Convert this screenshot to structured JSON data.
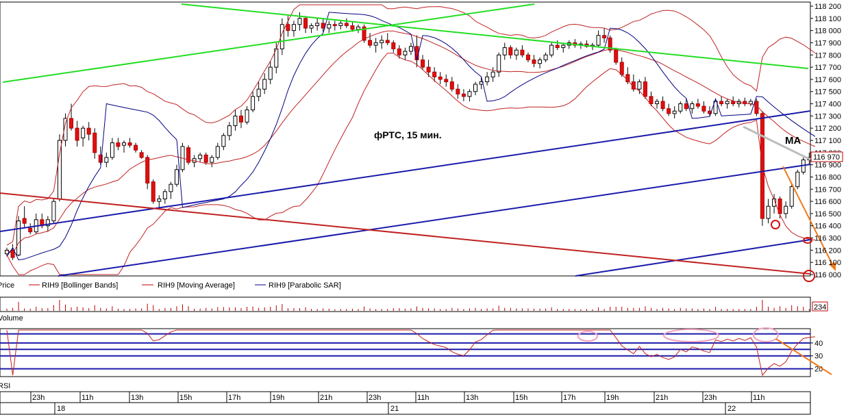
{
  "chart_data": {
    "type": "candlestick",
    "title": "фРТС,  15 мин.",
    "annotation_ma": "MA",
    "price_axis": {
      "ylim": [
        116000,
        118200
      ],
      "ticks": [
        118200,
        118100,
        118000,
        117900,
        117800,
        117700,
        117600,
        117500,
        117400,
        117300,
        117200,
        117100,
        117000,
        116900,
        116800,
        116700,
        116600,
        116500,
        116400,
        116300,
        116200,
        116100,
        116000
      ],
      "tick_labels": [
        "118 200",
        "118 100",
        "118 000",
        "117 900",
        "117 800",
        "117 700",
        "117 600",
        "117 500",
        "117 400",
        "117 300",
        "117 200",
        "117 100",
        "117 000",
        "116 900",
        "116 800",
        "116 700",
        "116 600",
        "116 500",
        "116 400",
        "116 300",
        "116 200",
        "116 100",
        "116 000"
      ],
      "last_price_label": "116 970",
      "last_price": 116970
    },
    "legend": [
      {
        "name": "Price",
        "color": "#000000"
      },
      {
        "name": "RIH9 [Bollinger Bands]",
        "color": "#c00000"
      },
      {
        "name": "RIH9 [Moving Average]",
        "color": "#c00000"
      },
      {
        "name": "RIH9 [Parabolic SAR]",
        "color": "#000080"
      }
    ],
    "volume_panel": {
      "label": "Volume",
      "last_value_label": "234"
    },
    "rsi_panel": {
      "label": "RSI",
      "levels": [
        47,
        40,
        35,
        30,
        20
      ],
      "tick_labels": [
        "40",
        "30",
        "20"
      ]
    },
    "time_axis": {
      "hour_labels": [
        "23h",
        "11h",
        "13h",
        "15h",
        "17h",
        "19h",
        "21h",
        "23h",
        "11h",
        "13h",
        "15h",
        "17h",
        "19h",
        "21h",
        "23h",
        "11h"
      ],
      "day_labels": [
        "18",
        "21",
        "22"
      ]
    },
    "candles": [
      [
        116170,
        116220,
        116150,
        116200
      ],
      [
        116200,
        116250,
        116120,
        116140
      ],
      [
        116160,
        116480,
        116150,
        116440
      ],
      [
        116460,
        116560,
        116380,
        116420
      ],
      [
        116380,
        116420,
        116330,
        116350
      ],
      [
        116350,
        116500,
        116330,
        116450
      ],
      [
        116450,
        116500,
        116380,
        116400
      ],
      [
        116400,
        116480,
        116350,
        116450
      ],
      [
        116440,
        116620,
        116420,
        116600
      ],
      [
        116620,
        117150,
        116600,
        117100
      ],
      [
        117100,
        117320,
        117050,
        117280
      ],
      [
        117280,
        117400,
        117180,
        117200
      ],
      [
        117200,
        117260,
        117050,
        117100
      ],
      [
        117120,
        117220,
        117050,
        117200
      ],
      [
        117200,
        117250,
        117100,
        117150
      ],
      [
        117160,
        117200,
        116950,
        117000
      ],
      [
        116980,
        117050,
        116900,
        116920
      ],
      [
        116920,
        117000,
        116880,
        116960
      ],
      [
        116960,
        117120,
        116940,
        117080
      ],
      [
        117080,
        117120,
        117020,
        117050
      ],
      [
        117060,
        117100,
        117000,
        117080
      ],
      [
        117080,
        117120,
        117040,
        117060
      ],
      [
        117060,
        117080,
        117000,
        117020
      ],
      [
        117000,
        117020,
        116950,
        116960
      ],
      [
        116960,
        116980,
        116700,
        116750
      ],
      [
        116760,
        116780,
        116580,
        116600
      ],
      [
        116600,
        116650,
        116550,
        116620
      ],
      [
        116620,
        116700,
        116580,
        116680
      ],
      [
        116680,
        116760,
        116620,
        116740
      ],
      [
        116740,
        116900,
        116720,
        116860
      ],
      [
        116860,
        117080,
        116840,
        117050
      ],
      [
        117040,
        117060,
        116900,
        116920
      ],
      [
        116920,
        116980,
        116880,
        116950
      ],
      [
        116950,
        117000,
        116920,
        116980
      ],
      [
        116980,
        117000,
        116900,
        116920
      ],
      [
        116920,
        116980,
        116880,
        116960
      ],
      [
        116960,
        117080,
        116940,
        117050
      ],
      [
        117050,
        117160,
        117020,
        117140
      ],
      [
        117140,
        117250,
        117100,
        117220
      ],
      [
        117220,
        117350,
        117180,
        117300
      ],
      [
        117300,
        117350,
        117200,
        117250
      ],
      [
        117250,
        117380,
        117230,
        117350
      ],
      [
        117350,
        117500,
        117330,
        117460
      ],
      [
        117460,
        117580,
        117420,
        117520
      ],
      [
        117520,
        117650,
        117480,
        117600
      ],
      [
        117600,
        117750,
        117560,
        117700
      ],
      [
        117700,
        117900,
        117650,
        117850
      ],
      [
        117850,
        118100,
        117800,
        118050
      ],
      [
        118050,
        118120,
        117950,
        118000
      ],
      [
        118000,
        118080,
        117950,
        118050
      ],
      [
        118050,
        118150,
        118000,
        118100
      ],
      [
        118100,
        118120,
        117980,
        118020
      ],
      [
        118020,
        118060,
        117980,
        118040
      ],
      [
        118040,
        118100,
        118000,
        118060
      ],
      [
        118060,
        118100,
        117990,
        118020
      ],
      [
        118020,
        118080,
        117980,
        118050
      ],
      [
        118050,
        118080,
        118000,
        118040
      ],
      [
        118040,
        118080,
        118010,
        118060
      ],
      [
        118060,
        118100,
        118020,
        118040
      ],
      [
        118040,
        118070,
        117990,
        118010
      ],
      [
        118010,
        118050,
        117980,
        118030
      ],
      [
        118030,
        118050,
        117900,
        117920
      ],
      [
        117920,
        117980,
        117860,
        117880
      ],
      [
        117880,
        117940,
        117820,
        117900
      ],
      [
        117900,
        117960,
        117850,
        117920
      ],
      [
        117920,
        117980,
        117880,
        117900
      ],
      [
        117900,
        117920,
        117820,
        117850
      ],
      [
        117850,
        117880,
        117770,
        117800
      ],
      [
        117800,
        117860,
        117760,
        117830
      ],
      [
        117830,
        117900,
        117800,
        117870
      ],
      [
        117870,
        117960,
        117700,
        117760
      ],
      [
        117760,
        117800,
        117680,
        117700
      ],
      [
        117700,
        117760,
        117620,
        117660
      ],
      [
        117660,
        117700,
        117580,
        117620
      ],
      [
        117620,
        117660,
        117560,
        117600
      ],
      [
        117600,
        117640,
        117540,
        117580
      ],
      [
        117580,
        117620,
        117500,
        117520
      ],
      [
        117520,
        117560,
        117440,
        117480
      ],
      [
        117480,
        117520,
        117420,
        117460
      ],
      [
        117460,
        117520,
        117420,
        117500
      ],
      [
        117500,
        117580,
        117470,
        117560
      ],
      [
        117560,
        117620,
        117520,
        117580
      ],
      [
        117580,
        117660,
        117550,
        117620
      ],
      [
        117620,
        117700,
        117580,
        117660
      ],
      [
        117660,
        117820,
        117620,
        117800
      ],
      [
        117800,
        117900,
        117760,
        117860
      ],
      [
        117860,
        117880,
        117770,
        117800
      ],
      [
        117800,
        117860,
        117760,
        117840
      ],
      [
        117840,
        117880,
        117780,
        117800
      ],
      [
        117800,
        117820,
        117740,
        117760
      ],
      [
        117760,
        117800,
        117700,
        117730
      ],
      [
        117730,
        117780,
        117690,
        117760
      ],
      [
        117760,
        117820,
        117740,
        117800
      ],
      [
        117800,
        117900,
        117780,
        117880
      ],
      [
        117880,
        117920,
        117840,
        117860
      ],
      [
        117860,
        117900,
        117820,
        117880
      ],
      [
        117880,
        117920,
        117850,
        117900
      ],
      [
        117900,
        117930,
        117860,
        117880
      ],
      [
        117880,
        117910,
        117850,
        117890
      ],
      [
        117890,
        117920,
        117860,
        117870
      ],
      [
        117870,
        117900,
        117840,
        117880
      ],
      [
        117880,
        118000,
        117860,
        117960
      ],
      [
        117960,
        118020,
        117900,
        117940
      ],
      [
        117940,
        117960,
        117820,
        117840
      ],
      [
        117840,
        117860,
        117720,
        117740
      ],
      [
        117740,
        117780,
        117620,
        117640
      ],
      [
        117640,
        117700,
        117560,
        117580
      ],
      [
        117580,
        117640,
        117500,
        117520
      ],
      [
        117520,
        117600,
        117480,
        117580
      ],
      [
        117580,
        117620,
        117440,
        117460
      ],
      [
        117460,
        117500,
        117380,
        117400
      ],
      [
        117400,
        117440,
        117360,
        117420
      ],
      [
        117420,
        117460,
        117340,
        117360
      ],
      [
        117360,
        117400,
        117300,
        117320
      ],
      [
        117320,
        117380,
        117280,
        117340
      ],
      [
        117340,
        117420,
        117320,
        117400
      ],
      [
        117400,
        117440,
        117340,
        117360
      ],
      [
        117360,
        117420,
        117320,
        117400
      ],
      [
        117400,
        117440,
        117360,
        117380
      ],
      [
        117380,
        117420,
        117320,
        117340
      ],
      [
        117340,
        117380,
        117300,
        117320
      ],
      [
        117320,
        117440,
        117300,
        117420
      ],
      [
        117420,
        117460,
        117380,
        117400
      ],
      [
        117400,
        117440,
        117360,
        117420
      ],
      [
        117420,
        117460,
        117380,
        117400
      ],
      [
        117400,
        117440,
        117370,
        117420
      ],
      [
        117420,
        117450,
        117380,
        117400
      ],
      [
        117400,
        117440,
        117380,
        117420
      ],
      [
        117420,
        117440,
        117300,
        117320
      ],
      [
        117320,
        117340,
        116400,
        116460
      ],
      [
        116460,
        116620,
        116420,
        116560
      ],
      [
        116560,
        116660,
        116500,
        116620
      ],
      [
        116620,
        116640,
        116460,
        116500
      ],
      [
        116500,
        116600,
        116460,
        116560
      ],
      [
        116560,
        116740,
        116540,
        116720
      ],
      [
        116720,
        116860,
        116700,
        116840
      ],
      [
        116840,
        116960,
        116820,
        116940
      ],
      [
        116940,
        117000,
        116900,
        116960
      ],
      [
        116960,
        116980,
        116950,
        116970
      ]
    ]
  }
}
